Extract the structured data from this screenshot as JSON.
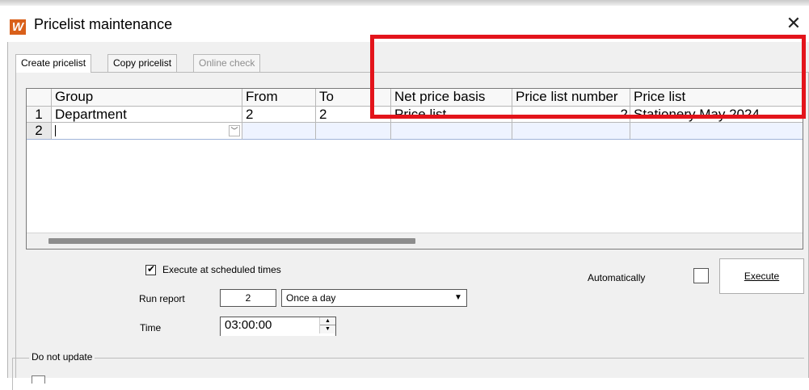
{
  "window": {
    "title": "Pricelist maintenance",
    "logo_letter": "W",
    "close_glyph": "✕"
  },
  "tabs": [
    {
      "label": "Create pricelist",
      "active": true,
      "enabled": true
    },
    {
      "label": "Copy pricelist",
      "active": false,
      "enabled": true
    },
    {
      "label": "Online check",
      "active": false,
      "enabled": false
    }
  ],
  "grid": {
    "columns": [
      "",
      "Group",
      "From",
      "To",
      "Net price basis",
      "Price list number",
      "Price list"
    ],
    "rows": [
      {
        "num": "1",
        "group": "Department",
        "from": "2",
        "to": "2",
        "net_price_basis": "Price list",
        "price_list_number": "2",
        "price_list": "Stationery May 2024"
      },
      {
        "num": "2",
        "group": "",
        "from": "",
        "to": "",
        "net_price_basis": "",
        "price_list_number": "",
        "price_list": ""
      }
    ],
    "combo_arrow_glyph": "﹀"
  },
  "schedule": {
    "execute_scheduled_label": "Execute at scheduled times",
    "execute_scheduled_checked": true,
    "run_report_label": "Run report",
    "run_report_value": "2",
    "frequency_selected": "Once a day",
    "select_arrow_glyph": "▼",
    "time_label": "Time",
    "time_value": "03:00:00",
    "spin_up_glyph": "▲",
    "spin_down_glyph": "▼"
  },
  "execution": {
    "automatically_label": "Automatically",
    "automatically_checked": false,
    "execute_button_label": "Execute"
  },
  "do_not_update": {
    "legend": "Do not update"
  },
  "colors": {
    "highlight": "#e3141b",
    "logo_bg": "#d9601a",
    "window_bg": "#f0f0f0"
  }
}
